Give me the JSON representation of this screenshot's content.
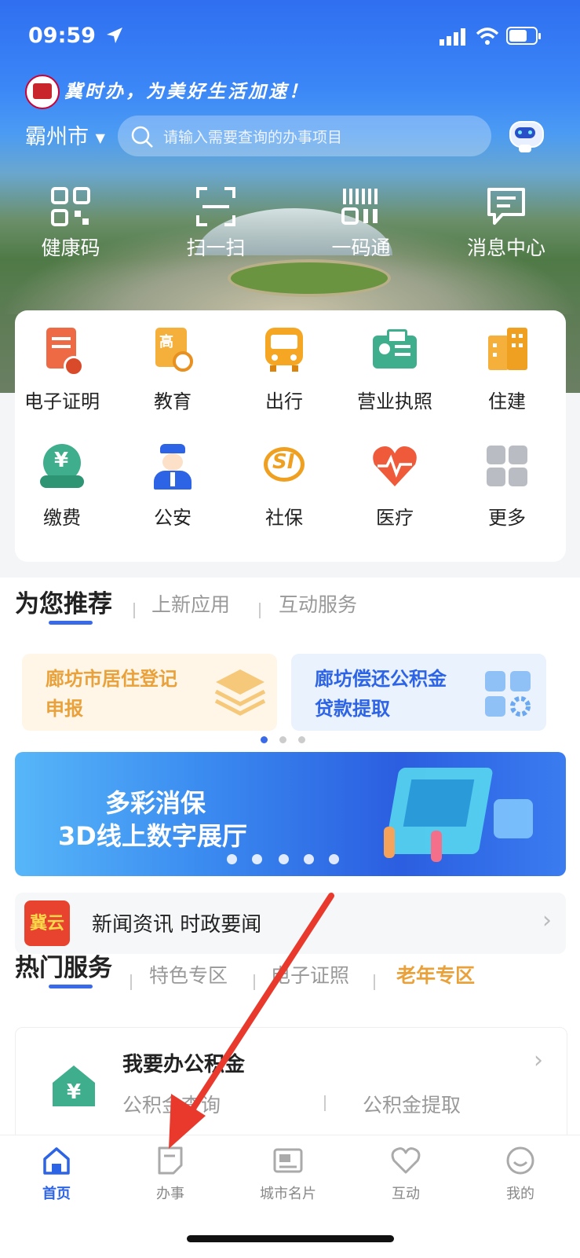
{
  "status_bar": {
    "time": "09:59"
  },
  "header": {
    "slogan": "冀时办，为美好生活加速！",
    "city": "霸州市",
    "search_placeholder": "请输入需要查询的办事项目"
  },
  "quick_actions": [
    {
      "label": "健康码",
      "icon": "health-code-icon"
    },
    {
      "label": "扫一扫",
      "icon": "scan-icon"
    },
    {
      "label": "一码通",
      "icon": "barcode-icon"
    },
    {
      "label": "消息中心",
      "icon": "message-icon"
    }
  ],
  "service_grid": [
    {
      "label": "电子证明",
      "icon": "e-certificate-icon"
    },
    {
      "label": "教育",
      "icon": "education-icon"
    },
    {
      "label": "出行",
      "icon": "bus-icon"
    },
    {
      "label": "营业执照",
      "icon": "business-license-icon"
    },
    {
      "label": "住建",
      "icon": "building-icon"
    },
    {
      "label": "缴费",
      "icon": "payment-icon"
    },
    {
      "label": "公安",
      "icon": "police-icon"
    },
    {
      "label": "社保",
      "icon": "social-security-icon"
    },
    {
      "label": "医疗",
      "icon": "medical-heart-icon"
    },
    {
      "label": "更多",
      "icon": "more-grid-icon"
    }
  ],
  "recommend": {
    "tabs": [
      "为您推荐",
      "上新应用",
      "互动服务"
    ],
    "cards": [
      {
        "line1": "廊坊市居住登记",
        "line2": "申报"
      },
      {
        "line1": "廊坊偿还公积金",
        "line2": "贷款提取"
      }
    ]
  },
  "banner": {
    "line1": "多彩消保",
    "line2": "3D线上数字展厅"
  },
  "news": {
    "logo_text": "冀云",
    "title": "新闻资讯 时政要闻"
  },
  "hot": {
    "tabs": [
      "热门服务",
      "特色专区",
      "电子证照",
      "老年专区"
    ],
    "card": {
      "title": "我要办公积金",
      "links": [
        "公积金查询",
        "公积金提取"
      ]
    }
  },
  "tabbar": [
    {
      "label": "首页",
      "icon": "home-icon"
    },
    {
      "label": "办事",
      "icon": "document-icon"
    },
    {
      "label": "城市名片",
      "icon": "city-card-icon"
    },
    {
      "label": "互动",
      "icon": "heart-icon"
    },
    {
      "label": "我的",
      "icon": "profile-icon"
    }
  ],
  "colors": {
    "primary": "#2d64e6",
    "accent_orange": "#e9a23b",
    "annotation_arrow": "#e8392c"
  }
}
